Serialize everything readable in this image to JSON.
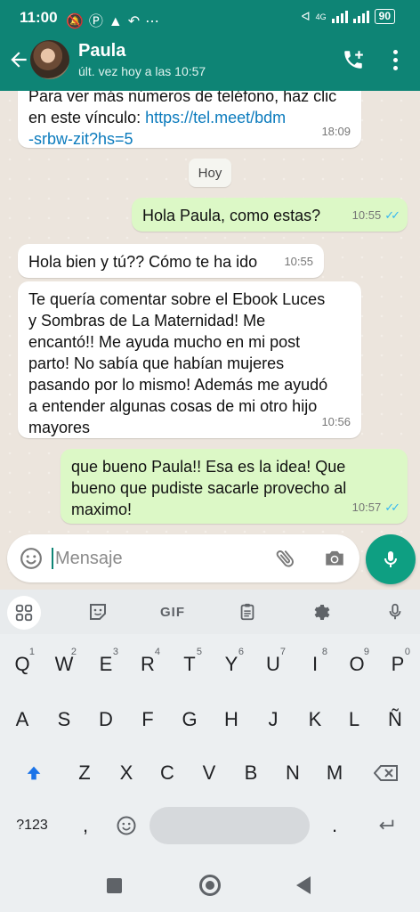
{
  "status_bar": {
    "time": "11:00",
    "network": "4G",
    "battery": "90"
  },
  "header": {
    "contact_name": "Paula",
    "contact_status": "últ. vez hoy a las 10:57"
  },
  "chat": {
    "messages": [
      {
        "text_prefix": "Para ver más números de teléfono, haz clic en este vínculo: ",
        "link": "https://tel.meet/bdm-srbw-zit?hs=5",
        "link_line1": "https://tel.meet/bdm",
        "link_line2": "-srbw-zit?hs=5",
        "time": "18:09",
        "direction": "in"
      },
      {
        "day_label": "Hoy"
      },
      {
        "text": "Hola Paula, como estas?",
        "time": "10:55",
        "direction": "out",
        "read": true
      },
      {
        "text": "Hola bien y tú?? Cómo te ha ido",
        "time": "10:55",
        "direction": "in"
      },
      {
        "text": "Te quería comentar sobre el Ebook Luces y Sombras de La Maternidad! Me encantó!! Me ayuda mucho en mi post parto! No sabía que habían mujeres pasando por lo mismo! Además me ayudó a entender algunas cosas de mi otro hijo mayores",
        "time": "10:56",
        "direction": "in"
      },
      {
        "text": "que bueno Paula!! Esa es la idea! Que bueno que pudiste sacarle provecho al maximo!",
        "time": "10:57",
        "direction": "out",
        "read": true
      }
    ]
  },
  "input": {
    "placeholder": "Mensaje"
  },
  "keyboard": {
    "toolbar": {
      "gif_label": "GIF"
    },
    "row1": [
      {
        "k": "Q",
        "h": "1"
      },
      {
        "k": "W",
        "h": "2"
      },
      {
        "k": "E",
        "h": "3"
      },
      {
        "k": "R",
        "h": "4"
      },
      {
        "k": "T",
        "h": "5"
      },
      {
        "k": "Y",
        "h": "6"
      },
      {
        "k": "U",
        "h": "7"
      },
      {
        "k": "I",
        "h": "8"
      },
      {
        "k": "O",
        "h": "9"
      },
      {
        "k": "P",
        "h": "0"
      }
    ],
    "row2": [
      "A",
      "S",
      "D",
      "F",
      "G",
      "H",
      "J",
      "K",
      "L",
      "Ñ"
    ],
    "row3": [
      "Z",
      "X",
      "C",
      "V",
      "B",
      "N",
      "M"
    ],
    "sym_label": "?123",
    "comma": ",",
    "period": "."
  },
  "colors": {
    "header": "#0e8475",
    "outgoing_bubble": "#dcf8c6",
    "incoming_bubble": "#ffffff",
    "accent": "#0e9f82",
    "read_ticks": "#34b7f1"
  },
  "icons": {
    "back": "arrow-left-icon",
    "call": "add-call-icon",
    "menu": "more-vert-icon",
    "emoji": "smiley-icon",
    "attach": "paperclip-icon",
    "camera": "camera-icon",
    "mic": "microphone-icon"
  }
}
